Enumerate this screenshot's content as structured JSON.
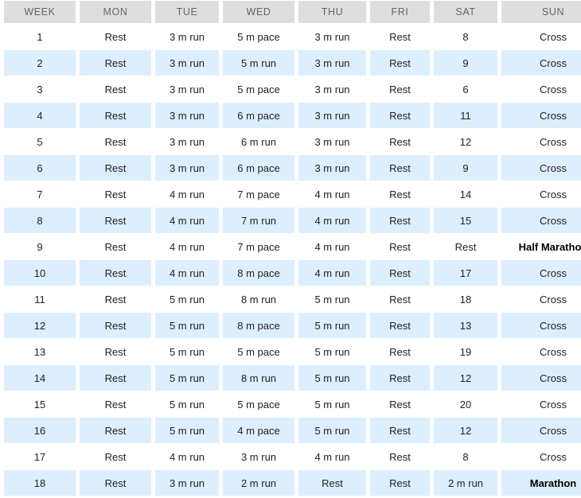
{
  "table": {
    "columns": [
      "WEEK",
      "MON",
      "TUE",
      "WED",
      "THU",
      "FRI",
      "SAT",
      "SUN"
    ],
    "colors": {
      "header_background": "#dedede",
      "header_text": "#666666",
      "stripe_background": "#ddeeff",
      "row_background": "#ffffff",
      "body_text": "#222222"
    },
    "rows": [
      {
        "week": "1",
        "mon": "Rest",
        "tue": "3 m run",
        "wed": "5 m pace",
        "thu": "3 m run",
        "fri": "Rest",
        "sat": "8",
        "sun": "Cross",
        "sun_bold": false,
        "striped": false
      },
      {
        "week": "2",
        "mon": "Rest",
        "tue": "3 m run",
        "wed": "5 m run",
        "thu": "3 m run",
        "fri": "Rest",
        "sat": "9",
        "sun": "Cross",
        "sun_bold": false,
        "striped": true
      },
      {
        "week": "3",
        "mon": "Rest",
        "tue": "3 m run",
        "wed": "5 m pace",
        "thu": "3 m run",
        "fri": "Rest",
        "sat": "6",
        "sun": "Cross",
        "sun_bold": false,
        "striped": false
      },
      {
        "week": "4",
        "mon": "Rest",
        "tue": "3 m run",
        "wed": "6 m pace",
        "thu": "3 m run",
        "fri": "Rest",
        "sat": "11",
        "sun": "Cross",
        "sun_bold": false,
        "striped": true
      },
      {
        "week": "5",
        "mon": "Rest",
        "tue": "3 m run",
        "wed": "6 m run",
        "thu": "3 m run",
        "fri": "Rest",
        "sat": "12",
        "sun": "Cross",
        "sun_bold": false,
        "striped": false
      },
      {
        "week": "6",
        "mon": "Rest",
        "tue": "3 m run",
        "wed": "6 m pace",
        "thu": "3 m run",
        "fri": "Rest",
        "sat": "9",
        "sun": "Cross",
        "sun_bold": false,
        "striped": true
      },
      {
        "week": "7",
        "mon": "Rest",
        "tue": "4 m run",
        "wed": "7 m pace",
        "thu": "4 m run",
        "fri": "Rest",
        "sat": "14",
        "sun": "Cross",
        "sun_bold": false,
        "striped": false
      },
      {
        "week": "8",
        "mon": "Rest",
        "tue": "4 m run",
        "wed": "7 m run",
        "thu": "4 m run",
        "fri": "Rest",
        "sat": "15",
        "sun": "Cross",
        "sun_bold": false,
        "striped": true
      },
      {
        "week": "9",
        "mon": "Rest",
        "tue": "4 m run",
        "wed": "7 m pace",
        "thu": "4 m run",
        "fri": "Rest",
        "sat": "Rest",
        "sun": "Half Marathon",
        "sun_bold": true,
        "striped": false
      },
      {
        "week": "10",
        "mon": "Rest",
        "tue": "4 m run",
        "wed": "8 m pace",
        "thu": "4 m run",
        "fri": "Rest",
        "sat": "17",
        "sun": "Cross",
        "sun_bold": false,
        "striped": true
      },
      {
        "week": "11",
        "mon": "Rest",
        "tue": "5 m run",
        "wed": "8 m run",
        "thu": "5 m run",
        "fri": "Rest",
        "sat": "18",
        "sun": "Cross",
        "sun_bold": false,
        "striped": false
      },
      {
        "week": "12",
        "mon": "Rest",
        "tue": "5 m run",
        "wed": "8 m pace",
        "thu": "5 m run",
        "fri": "Rest",
        "sat": "13",
        "sun": "Cross",
        "sun_bold": false,
        "striped": true
      },
      {
        "week": "13",
        "mon": "Rest",
        "tue": "5 m run",
        "wed": "5 m pace",
        "thu": "5 m run",
        "fri": "Rest",
        "sat": "19",
        "sun": "Cross",
        "sun_bold": false,
        "striped": false
      },
      {
        "week": "14",
        "mon": "Rest",
        "tue": "5 m run",
        "wed": "8 m run",
        "thu": "5 m run",
        "fri": "Rest",
        "sat": "12",
        "sun": "Cross",
        "sun_bold": false,
        "striped": true
      },
      {
        "week": "15",
        "mon": "Rest",
        "tue": "5 m run",
        "wed": "5 m pace",
        "thu": "5 m run",
        "fri": "Rest",
        "sat": "20",
        "sun": "Cross",
        "sun_bold": false,
        "striped": false
      },
      {
        "week": "16",
        "mon": "Rest",
        "tue": "5 m run",
        "wed": "4 m pace",
        "thu": "5 m run",
        "fri": "Rest",
        "sat": "12",
        "sun": "Cross",
        "sun_bold": false,
        "striped": true
      },
      {
        "week": "17",
        "mon": "Rest",
        "tue": "4 m run",
        "wed": "3 m run",
        "thu": "4 m run",
        "fri": "Rest",
        "sat": "8",
        "sun": "Cross",
        "sun_bold": false,
        "striped": false
      },
      {
        "week": "18",
        "mon": "Rest",
        "tue": "3 m run",
        "wed": "2 m run",
        "thu": "Rest",
        "fri": "Rest",
        "sat": "2 m run",
        "sun": "Marathon",
        "sun_bold": true,
        "striped": true
      }
    ]
  }
}
